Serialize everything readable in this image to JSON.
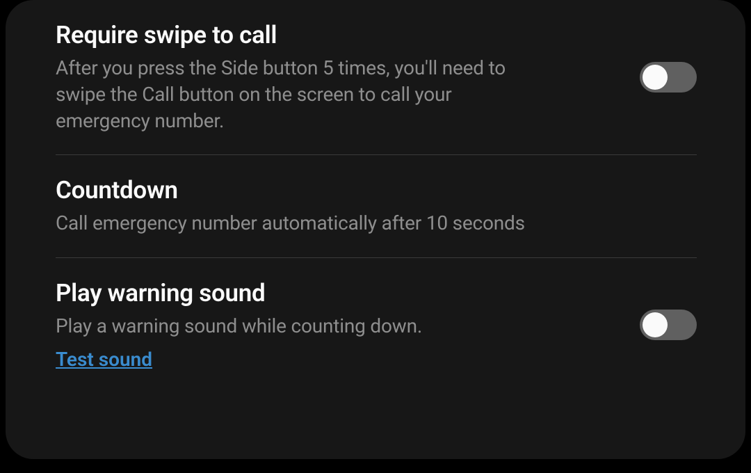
{
  "items": [
    {
      "title": "Require swipe to call",
      "desc": "After you press the Side button 5 times, you'll need to swipe the Call button on the screen to call your emergency number.",
      "toggle": false
    },
    {
      "title": "Countdown",
      "desc": "Call emergency number automatically after 10 seconds"
    },
    {
      "title": "Play warning sound",
      "desc": "Play a warning sound while counting down.",
      "link": "Test sound",
      "toggle": false
    }
  ]
}
